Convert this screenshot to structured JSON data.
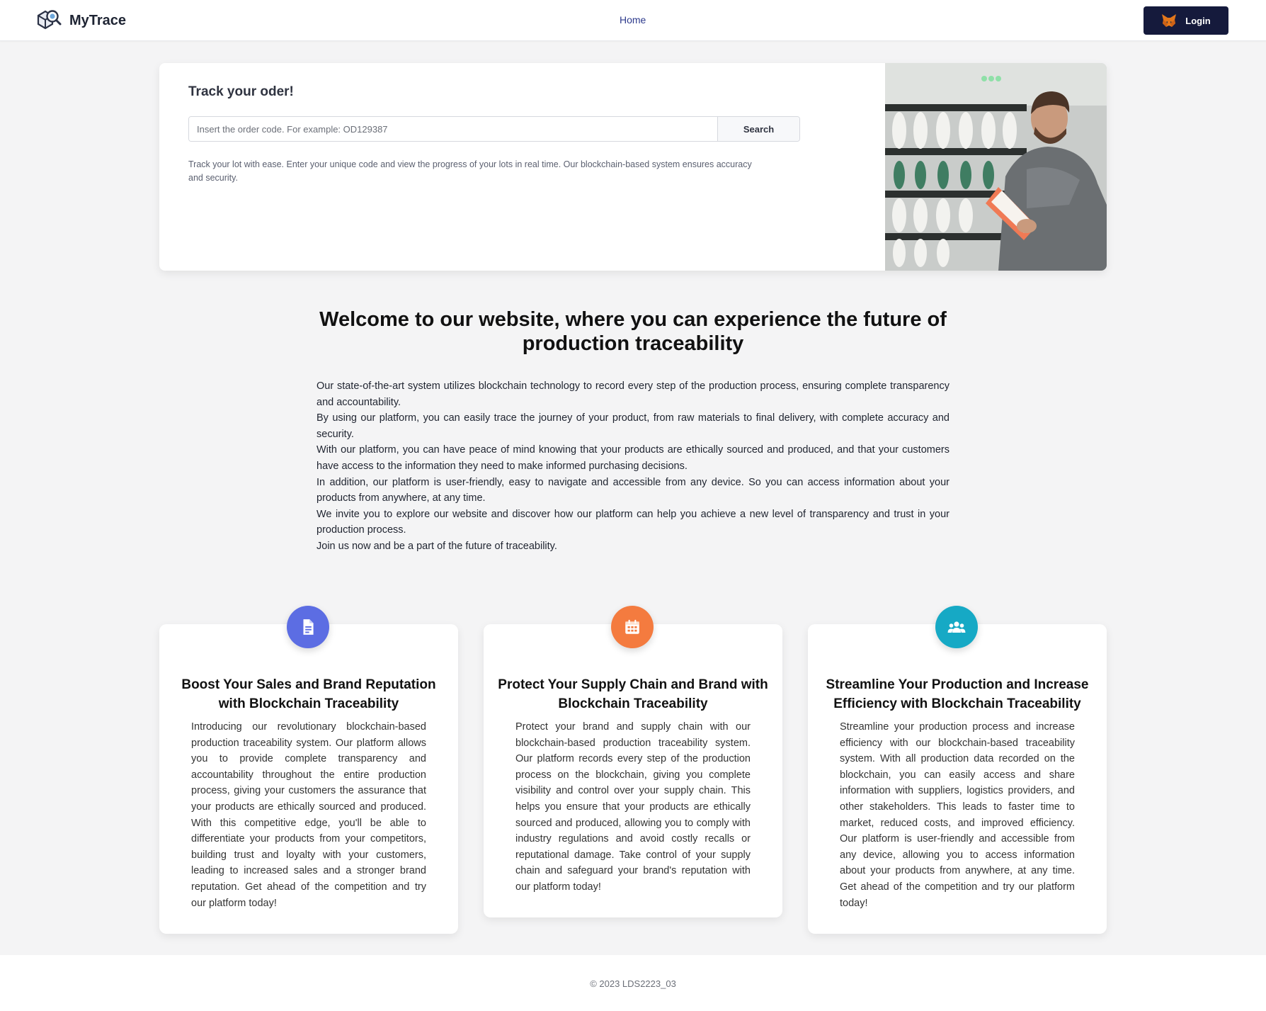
{
  "header": {
    "brand_name": "MyTrace",
    "nav_home": "Home",
    "login_label": "Login"
  },
  "track": {
    "title": "Track your oder!",
    "search_placeholder": "Insert the order code. For example: OD129387",
    "search_button": "Search",
    "description": "Track your lot with ease. Enter your unique code and view the progress of your lots in real time. Our blockchain-based system ensures accuracy and security."
  },
  "welcome": {
    "title": "Welcome to our website, where you can experience the future of production traceability",
    "paragraphs": [
      "Our state-of-the-art system utilizes blockchain technology to record every step of the production process, ensuring complete transparency and accountability.",
      "By using our platform, you can easily trace the journey of your product, from raw materials to final delivery, with complete accuracy and security.",
      "With our platform, you can have peace of mind knowing that your products are ethically sourced and produced, and that your customers have access to the information they need to make informed purchasing decisions.",
      "In addition, our platform is user-friendly, easy to navigate and accessible from any device. So you can access information about your products from anywhere, at any time.",
      "We invite you to explore our website and discover how our platform can help you achieve a new level of transparency and trust in your production process.",
      "Join us now and be a part of the future of traceability."
    ]
  },
  "features": [
    {
      "icon": "document-icon",
      "color": "#5c6de3",
      "title": "Boost Your Sales and Brand Reputation with Blockchain Traceability",
      "text": "Introducing our revolutionary blockchain-based production traceability system. Our platform allows you to provide complete transparency and accountability throughout the entire production process, giving your customers the assurance that your products are ethically sourced and produced. With this competitive edge, you'll be able to differentiate your products from your competitors, building trust and loyalty with your customers, leading to increased sales and a stronger brand reputation. Get ahead of the competition and try our platform today!"
    },
    {
      "icon": "calendar-icon",
      "color": "#f47b3f",
      "title": "Protect Your Supply Chain and Brand with Blockchain Traceability",
      "text": "Protect your brand and supply chain with our blockchain-based production traceability system. Our platform records every step of the production process on the blockchain, giving you complete visibility and control over your supply chain. This helps you ensure that your products are ethically sourced and produced, allowing you to comply with industry regulations and avoid costly recalls or reputational damage. Take control of your supply chain and safeguard your brand's reputation with our platform today!"
    },
    {
      "icon": "team-icon",
      "color": "#16a9c5",
      "title": "Streamline Your Production and Increase Efficiency with Blockchain Traceability",
      "text": "Streamline your production process and increase efficiency with our blockchain-based traceability system. With all production data recorded on the blockchain, you can easily access and share information with suppliers, logistics providers, and other stakeholders. This leads to faster time to market, reduced costs, and improved efficiency. Our platform is user-friendly and accessible from any device, allowing you to access information about your products from anywhere, at any time. Get ahead of the competition and try our platform today!"
    }
  ],
  "footer": {
    "copyright": "© 2023 LDS2223_03"
  }
}
